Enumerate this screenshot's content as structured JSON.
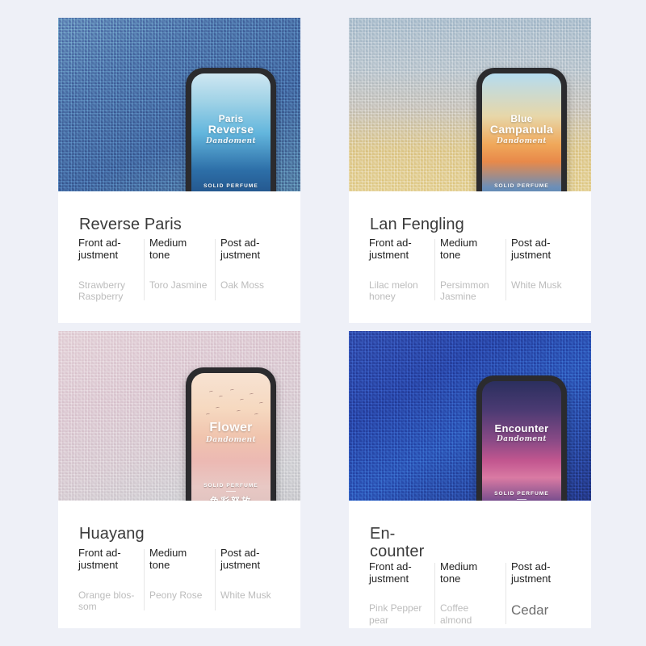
{
  "page": {
    "background_color": "#eef0f7",
    "layout": "2x2-product-grid"
  },
  "note_headers": {
    "front": "Front ad-justment",
    "medium": "Medium tone",
    "post": "Post ad-justment"
  },
  "product_labels": {
    "solid_perfume": "SOLID PERFUME",
    "chinese": "色彩怒放",
    "script": "Dandoment"
  },
  "cards": [
    {
      "id": "card-reverse-paris",
      "title": "Reverse Paris",
      "fabric_color": "#4a6fa6",
      "product": {
        "name_line1": "Paris",
        "name_line2": "Reverse",
        "face_colors": [
          "#cfe7f2",
          "#2d6fa8",
          "#1b3f74"
        ]
      },
      "notes": [
        {
          "header": "Front ad-justment",
          "value": "Strawberry Raspberry",
          "emphasis": false
        },
        {
          "header": "Medium tone",
          "value": "Toro Jasmine",
          "emphasis": false
        },
        {
          "header": "Post ad-justment",
          "value": "Oak Moss",
          "emphasis": false
        }
      ]
    },
    {
      "id": "card-lan-fengling",
      "title": "Lan Fengling",
      "fabric_color": "#c8c4bc",
      "product": {
        "name_line1": "Blue",
        "name_line2": "Campanula",
        "face_colors": [
          "#b5dcf0",
          "#f0a85a",
          "#3a72ab"
        ]
      },
      "notes": [
        {
          "header": "Front ad-justment",
          "value": "Lilac melon honey",
          "emphasis": false
        },
        {
          "header": "Medium tone",
          "value": "Persimmon Jasmine",
          "emphasis": false
        },
        {
          "header": "Post ad-justment",
          "value": "White Musk",
          "emphasis": false
        }
      ]
    },
    {
      "id": "card-huayang",
      "title": "Huayang",
      "fabric_color": "#dcc9d2",
      "product": {
        "name_line1": "Flower",
        "name_line2": "",
        "face_colors": [
          "#f7e2d2",
          "#f0c4ae",
          "#dcc0bd"
        ]
      },
      "notes": [
        {
          "header": "Front ad-justment",
          "value": "Orange blos-som",
          "emphasis": false
        },
        {
          "header": "Medium tone",
          "value": "Peony Rose",
          "emphasis": false
        },
        {
          "header": "Post ad-justment",
          "value": "White Musk",
          "emphasis": false
        }
      ]
    },
    {
      "id": "card-encounter",
      "title": "En-counter",
      "fabric_color": "#2743a3",
      "product": {
        "name_line1": "Encounter",
        "name_line2": "",
        "face_colors": [
          "#2b2f5e",
          "#c2568f",
          "#2e2a55"
        ]
      },
      "notes": [
        {
          "header": "Front ad-justment",
          "value": "Pink Pepper pear",
          "emphasis": false
        },
        {
          "header": "Medium tone",
          "value": "Coffee almond",
          "emphasis": false
        },
        {
          "header": "Post ad-justment",
          "value": "Cedar",
          "emphasis": true
        }
      ]
    }
  ]
}
